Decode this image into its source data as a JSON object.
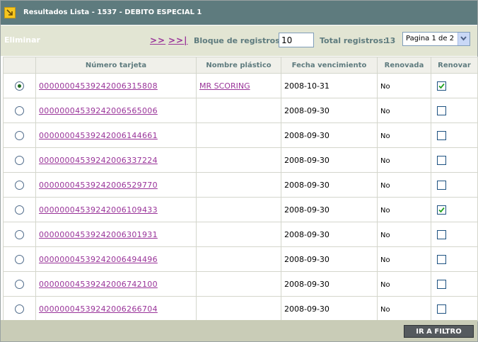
{
  "header": {
    "title": "Resultados Lista - 1537 - DEBITO ESPECIAL 1",
    "icon": "resize-arrow-icon"
  },
  "toolbar": {
    "eliminar_label": "Eliminar",
    "next_label": ">>",
    "last_label": ">>|",
    "bloque_label": "Bloque de registros:",
    "bloque_value": "10",
    "total_label": "Total registros:",
    "total_value": "13",
    "page_select": "Pagina 1 de 2"
  },
  "table": {
    "headers": [
      "Número tarjeta",
      "Nombre plástico",
      "Fecha vencimiento",
      "Renovada",
      "Renovar"
    ],
    "rows": [
      {
        "selected": true,
        "numero": "0000000453924200631580​8",
        "nombre": "MR SCORING",
        "fecha": "2008-10-31",
        "renovada": "No",
        "renovar": true
      },
      {
        "selected": false,
        "numero": "00000004539242006565006",
        "nombre": "",
        "fecha": "2008-09-30",
        "renovada": "No",
        "renovar": false
      },
      {
        "selected": false,
        "numero": "00000004539242006144661",
        "nombre": "",
        "fecha": "2008-09-30",
        "renovada": "No",
        "renovar": false
      },
      {
        "selected": false,
        "numero": "00000004539242006337224",
        "nombre": "",
        "fecha": "2008-09-30",
        "renovada": "No",
        "renovar": false
      },
      {
        "selected": false,
        "numero": "00000004539242006529770",
        "nombre": "",
        "fecha": "2008-09-30",
        "renovada": "No",
        "renovar": false
      },
      {
        "selected": false,
        "numero": "00000004539242006109433",
        "nombre": "",
        "fecha": "2008-09-30",
        "renovada": "No",
        "renovar": true
      },
      {
        "selected": false,
        "numero": "00000004539242006301931",
        "nombre": "",
        "fecha": "2008-09-30",
        "renovada": "No",
        "renovar": false
      },
      {
        "selected": false,
        "numero": "00000004539242006494496",
        "nombre": "",
        "fecha": "2008-09-30",
        "renovada": "No",
        "renovar": false
      },
      {
        "selected": false,
        "numero": "00000004539242006742100",
        "nombre": "",
        "fecha": "2008-09-30",
        "renovada": "No",
        "renovar": false
      },
      {
        "selected": false,
        "numero": "00000004539242006266704",
        "nombre": "",
        "fecha": "2008-09-30",
        "renovada": "No",
        "renovar": false
      }
    ]
  },
  "footer": {
    "ir_filtro_label": "IR A FILTRO"
  },
  "colors": {
    "title_bar": "#5e7b7e",
    "toolbar_bg": "#e2e5d3",
    "link": "#993399",
    "footer_bg": "#c9ccb7"
  }
}
